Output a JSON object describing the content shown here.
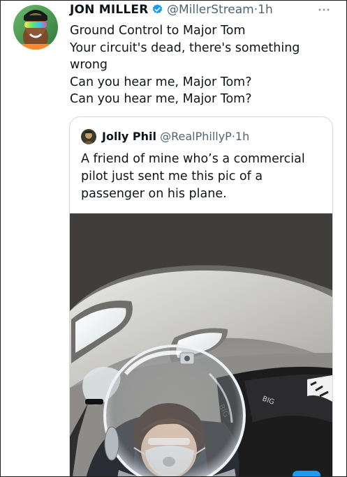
{
  "tweet": {
    "author_name": "JON MILLER",
    "handle": "@MillerStream",
    "separator": "·",
    "time": "1h",
    "lines": [
      "Ground Control to Major Tom",
      "Your circuit's dead, there's something wrong",
      "Can you hear me, Major Tom?",
      "Can you hear me, Major Tom?"
    ],
    "icons": {
      "verified": "verified-badge-icon",
      "more": "more-options-icon"
    },
    "colors": {
      "verified": "#1d9bf0",
      "text": "#0f1419",
      "secondary": "#536471",
      "border": "#cfd9de"
    }
  },
  "quoted_tweet": {
    "author_name": "Jolly Phil",
    "handle": "@RealPhillyP",
    "separator": "·",
    "time": "1h",
    "text": "A friend of mine who’s a commercial pilot just sent me this pic of a passenger on his plane.",
    "image_text": [
      "BIG",
      "BIG"
    ]
  }
}
